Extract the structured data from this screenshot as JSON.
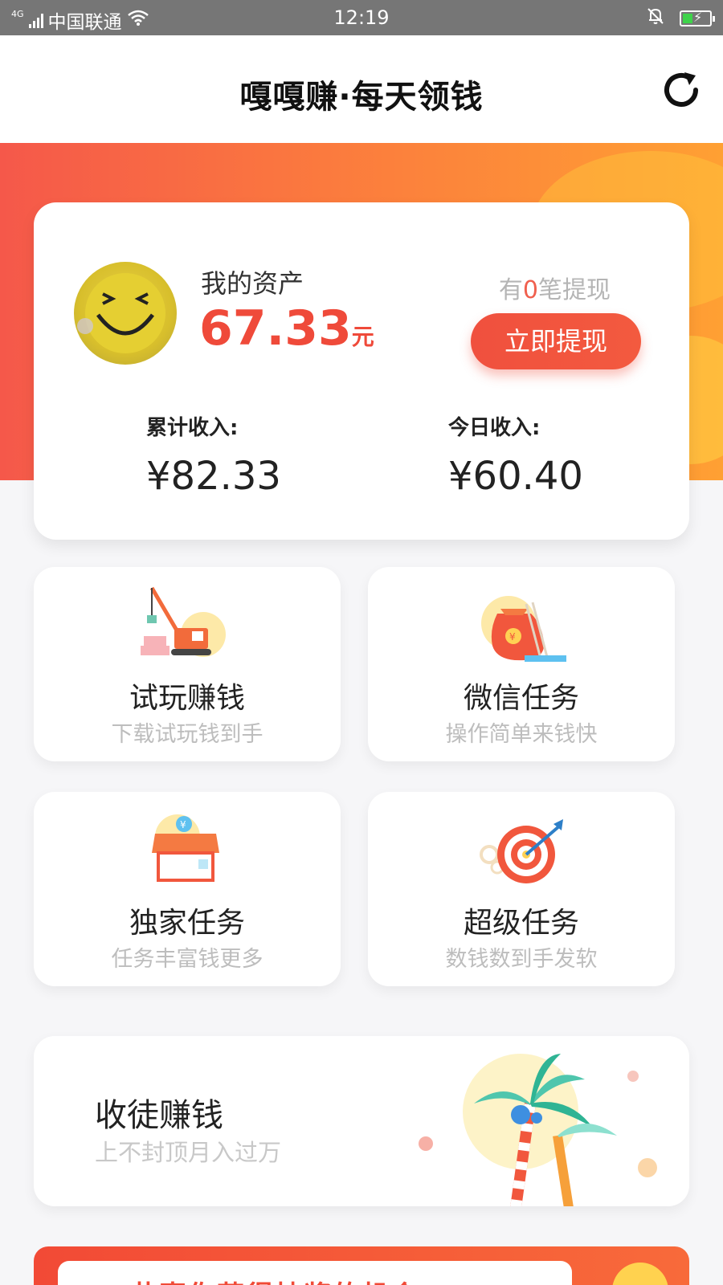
{
  "status_bar": {
    "network": "4G",
    "carrier": "中国联通",
    "time": "12:19"
  },
  "header": {
    "title": "嘎嘎赚·每天领钱",
    "refresh_icon": "refresh-icon"
  },
  "asset": {
    "label": "我的资产",
    "amount": "67.33",
    "unit": "元",
    "withdraw_prefix": "有",
    "withdraw_count": "0",
    "withdraw_suffix": "笔提现",
    "withdraw_button": "立即提现",
    "total_income_label": "累计收入:",
    "total_income_value": "¥82.33",
    "today_income_label": "今日收入:",
    "today_income_value": "¥60.40"
  },
  "tasks": [
    {
      "title": "试玩赚钱",
      "subtitle": "下载试玩钱到手",
      "icon": "crane-icon"
    },
    {
      "title": "微信任务",
      "subtitle": "操作简单来钱快",
      "icon": "money-bag-icon"
    },
    {
      "title": "独家任务",
      "subtitle": "任务丰富钱更多",
      "icon": "shop-icon"
    },
    {
      "title": "超级任务",
      "subtitle": "数钱数到手发软",
      "icon": "target-icon"
    }
  ],
  "invite": {
    "title": "收徒赚钱",
    "subtitle": "上不封顶月入过万",
    "icon": "palm-tree-icon"
  },
  "banner": {
    "text": "恭喜你获得抽奖的机会"
  },
  "colors": {
    "accent": "#ef4a3a",
    "hero_start": "#f5584a",
    "hero_end": "#ffa033"
  }
}
